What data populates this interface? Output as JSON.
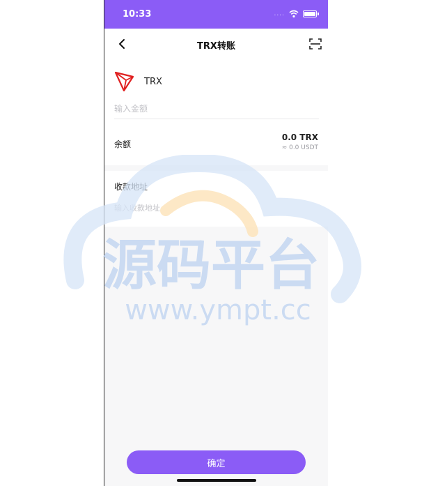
{
  "status_bar": {
    "time": "10:33",
    "signal": "....",
    "background": "#8b5cf6"
  },
  "nav": {
    "title": "TRX转账"
  },
  "coin": {
    "name": "TRX",
    "logo_color": "#e02020"
  },
  "amount": {
    "placeholder": "输入金额",
    "value": ""
  },
  "balance": {
    "label": "余额",
    "value": "0.0 TRX",
    "usdt": "≈ 0.0 USDT"
  },
  "address": {
    "label": "收款地址",
    "placeholder": "输入收款地址",
    "value": ""
  },
  "confirm_label": "确定",
  "watermark": {
    "title": "源码平台",
    "url": "www.ympt.cc"
  },
  "colors": {
    "accent": "#8b5cf6",
    "page_bg": "#f7f7f8"
  }
}
